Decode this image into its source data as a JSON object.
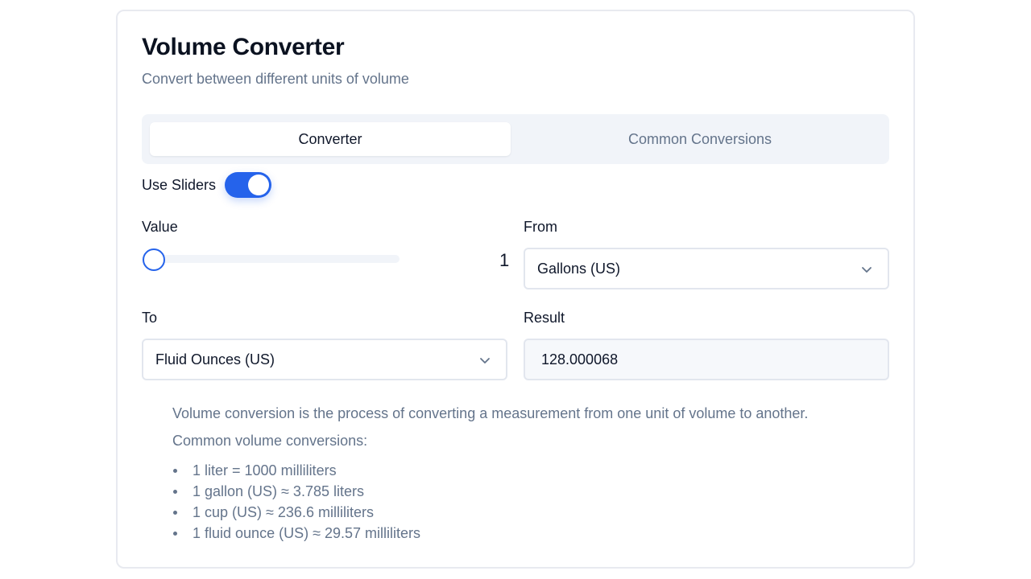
{
  "header": {
    "title": "Volume Converter",
    "subtitle": "Convert between different units of volume"
  },
  "tabs": [
    {
      "label": "Converter",
      "active": true
    },
    {
      "label": "Common Conversions",
      "active": false
    }
  ],
  "toggle": {
    "label": "Use Sliders",
    "on": true
  },
  "value_field": {
    "label": "Value",
    "value": "1",
    "slider_fraction": 0.0
  },
  "from_field": {
    "label": "From",
    "selected": "Gallons (US)"
  },
  "to_field": {
    "label": "To",
    "selected": "Fluid Ounces (US)"
  },
  "result_field": {
    "label": "Result",
    "value": "128.000068"
  },
  "info": {
    "intro": "Volume conversion is the process of converting a measurement from one unit of volume to another.",
    "list_heading": "Common volume conversions:",
    "items": [
      "1 liter = 1000 milliliters",
      "1 gallon (US) ≈ 3.785 liters",
      "1 cup (US) ≈ 236.6 milliliters",
      "1 fluid ounce (US) ≈ 29.57 milliliters"
    ]
  },
  "icons": {
    "select_indicator": "chevron-down-icon"
  },
  "colors": {
    "accent": "#2563eb",
    "muted_text": "#64748b",
    "tab_background": "#f1f4f9"
  }
}
